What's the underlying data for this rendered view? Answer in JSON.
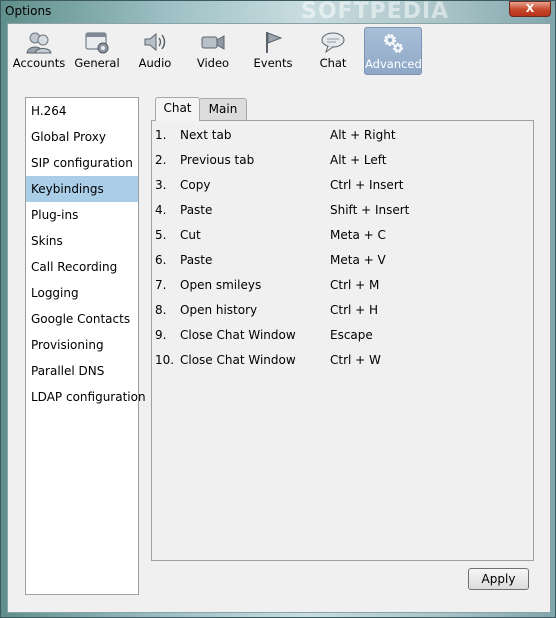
{
  "window": {
    "title": "Options",
    "close_label": "X",
    "watermark": "SOFTPEDIA"
  },
  "toolbar": {
    "items": [
      {
        "label": "Accounts",
        "icon": "accounts-icon"
      },
      {
        "label": "General",
        "icon": "general-icon"
      },
      {
        "label": "Audio",
        "icon": "audio-icon"
      },
      {
        "label": "Video",
        "icon": "video-icon"
      },
      {
        "label": "Events",
        "icon": "events-flag-icon"
      },
      {
        "label": "Chat",
        "icon": "chat-bubble-icon"
      },
      {
        "label": "Advanced",
        "icon": "advanced-gears-icon",
        "active": true
      }
    ]
  },
  "sidebar": {
    "items": [
      {
        "label": "H.264"
      },
      {
        "label": "Global Proxy"
      },
      {
        "label": "SIP configuration"
      },
      {
        "label": "Keybindings",
        "selected": true
      },
      {
        "label": "Plug-ins"
      },
      {
        "label": "Skins"
      },
      {
        "label": "Call Recording"
      },
      {
        "label": "Logging"
      },
      {
        "label": "Google Contacts"
      },
      {
        "label": "Provisioning"
      },
      {
        "label": "Parallel DNS"
      },
      {
        "label": "LDAP configuration"
      }
    ]
  },
  "tabs": [
    {
      "label": "Chat",
      "active": true
    },
    {
      "label": "Main"
    }
  ],
  "keybindings": [
    {
      "num": "1.",
      "action": "Next tab",
      "keys": "Alt + Right"
    },
    {
      "num": "2.",
      "action": "Previous tab",
      "keys": "Alt + Left"
    },
    {
      "num": "3.",
      "action": "Copy",
      "keys": "Ctrl + Insert"
    },
    {
      "num": "4.",
      "action": "Paste",
      "keys": "Shift + Insert"
    },
    {
      "num": "5.",
      "action": "Cut",
      "keys": "Meta + C"
    },
    {
      "num": "6.",
      "action": "Paste",
      "keys": "Meta + V"
    },
    {
      "num": "7.",
      "action": "Open smileys",
      "keys": "Ctrl + M"
    },
    {
      "num": "8.",
      "action": "Open history",
      "keys": "Ctrl + H"
    },
    {
      "num": "9.",
      "action": "Close Chat Window",
      "keys": "Escape"
    },
    {
      "num": "10.",
      "action": "Close Chat Window",
      "keys": "Ctrl + W"
    }
  ],
  "apply_label": "Apply"
}
